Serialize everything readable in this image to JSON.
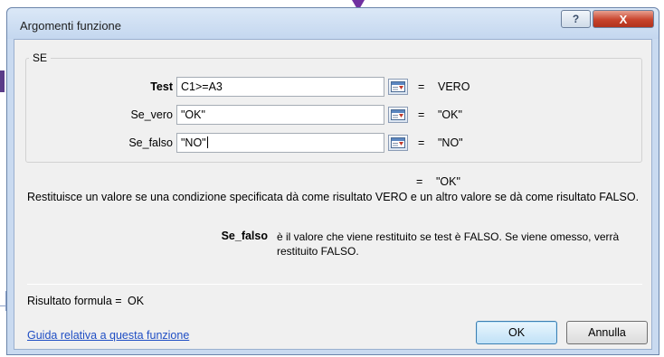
{
  "window": {
    "title": "Argomenti funzione",
    "help_label": "?",
    "close_label": "X"
  },
  "function": {
    "name": "SE",
    "args": [
      {
        "label": "Test",
        "value": "C1>=A3",
        "result": "VERO",
        "bold": true
      },
      {
        "label": "Se_vero",
        "value": "\"OK\"",
        "result": "\"OK\"",
        "bold": false
      },
      {
        "label": "Se_falso",
        "value": "\"NO\"",
        "result": "\"NO\"",
        "bold": false
      }
    ],
    "equals_sign": "=",
    "overall_result": "\"OK\"",
    "description": "Restituisce un valore se una condizione specificata dà come risultato VERO e un altro valore se dà come risultato FALSO.",
    "param_name": "Se_falso",
    "param_description": "è il valore che viene restituito se test è FALSO. Se viene omesso, verrà restituito FALSO."
  },
  "footer": {
    "result_label": "Risultato formula =",
    "result_value": "OK",
    "help_link": "Guida relativa a questa funzione",
    "ok_label": "OK",
    "cancel_label": "Annulla"
  },
  "colors": {
    "titlebar": "#c9daf0",
    "close_button": "#c8432c",
    "link": "#1f4ec4",
    "background_accent": "#7030a0"
  },
  "icons": [
    "collapse-dialog-icon"
  ]
}
